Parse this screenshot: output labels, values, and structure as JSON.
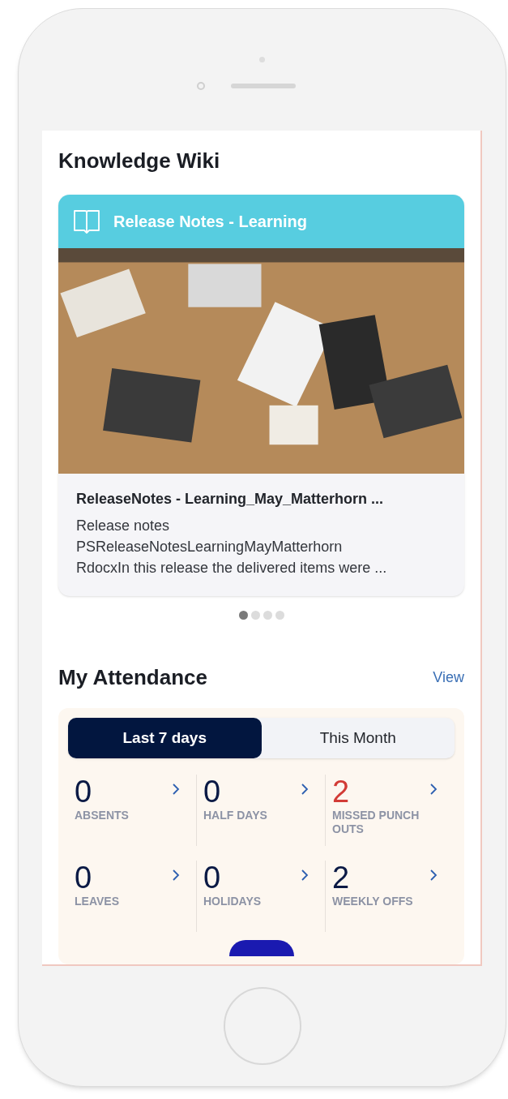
{
  "wiki": {
    "title": "Knowledge Wiki",
    "card": {
      "header": "Release Notes - Learning",
      "doc_title": "ReleaseNotes - Learning_May_Matterhorn ...",
      "lines": [
        "Release notes",
        "PSReleaseNotesLearningMayMatterhorn",
        "RdocxIn this release the delivered items were ..."
      ]
    },
    "dots": [
      {
        "selected": true
      },
      {
        "selected": false
      },
      {
        "selected": false
      },
      {
        "selected": false
      }
    ]
  },
  "attendance": {
    "title": "My Attendance",
    "link": "View",
    "tabs": [
      {
        "label": "Last 7 days",
        "selected": true
      },
      {
        "label": "This Month",
        "selected": false
      }
    ],
    "stats": [
      {
        "value": "0",
        "label": "ABSENTS",
        "color": "#0b1a45"
      },
      {
        "value": "0",
        "label": "HALF DAYS",
        "color": "#0b1a45"
      },
      {
        "value": "2",
        "label": "MISSED PUNCH OUTS",
        "color": "#d23b36"
      },
      {
        "value": "0",
        "label": "LEAVES",
        "color": "#0b1a45"
      },
      {
        "value": "0",
        "label": "HOLIDAYS",
        "color": "#0b1a45"
      },
      {
        "value": "2",
        "label": "WEEKLY OFFS",
        "color": "#0b1a45"
      }
    ]
  }
}
